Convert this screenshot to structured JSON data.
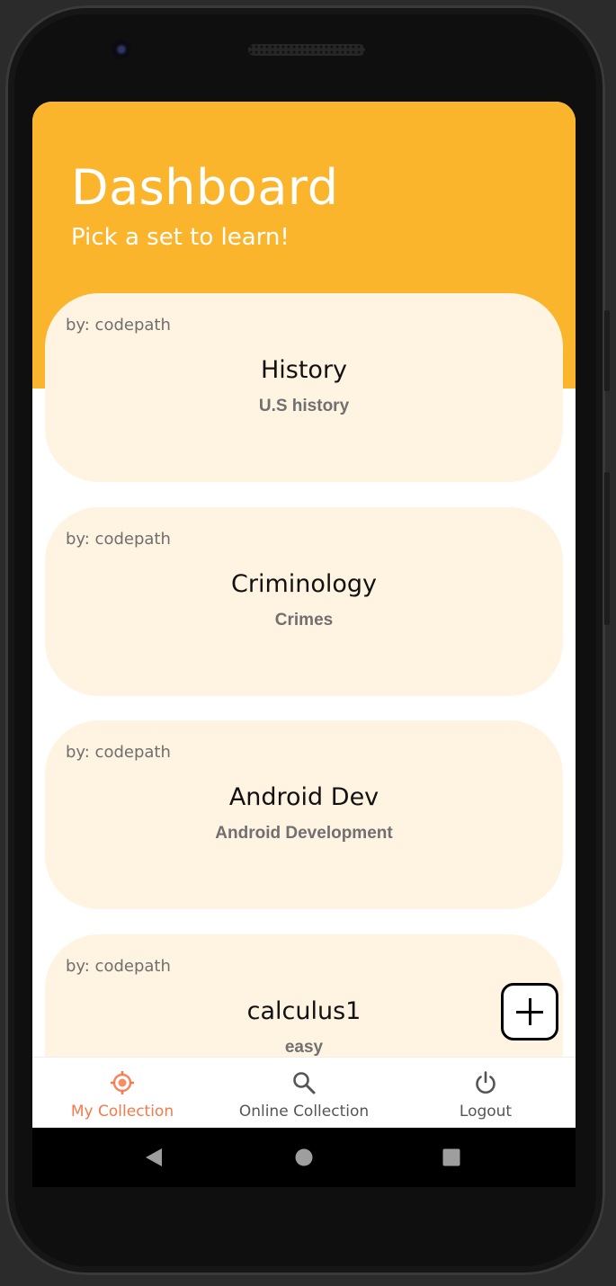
{
  "header": {
    "title": "Dashboard",
    "subtitle": "Pick a set to learn!",
    "color": "#FBB52C"
  },
  "cards": [
    {
      "author": "by: codepath",
      "name": "History",
      "description": "U.S history"
    },
    {
      "author": "by: codepath",
      "name": "Criminology",
      "description": "Crimes"
    },
    {
      "author": "by: codepath",
      "name": "Android Dev",
      "description": "Android Development"
    },
    {
      "author": "by: codepath",
      "name": "calculus1",
      "description": "easy"
    }
  ],
  "fab": {
    "icon": "add-box-icon"
  },
  "bottom_nav": {
    "items": [
      {
        "label": "My Collection",
        "icon": "target-icon",
        "active": true
      },
      {
        "label": "Online Collection",
        "icon": "search-icon",
        "active": false
      },
      {
        "label": "Logout",
        "icon": "power-icon",
        "active": false
      }
    ],
    "active_color": "#F5794A"
  },
  "system_nav": {
    "back_icon": "back-triangle-icon",
    "home_icon": "home-circle-icon",
    "recents_icon": "recents-square-icon"
  }
}
